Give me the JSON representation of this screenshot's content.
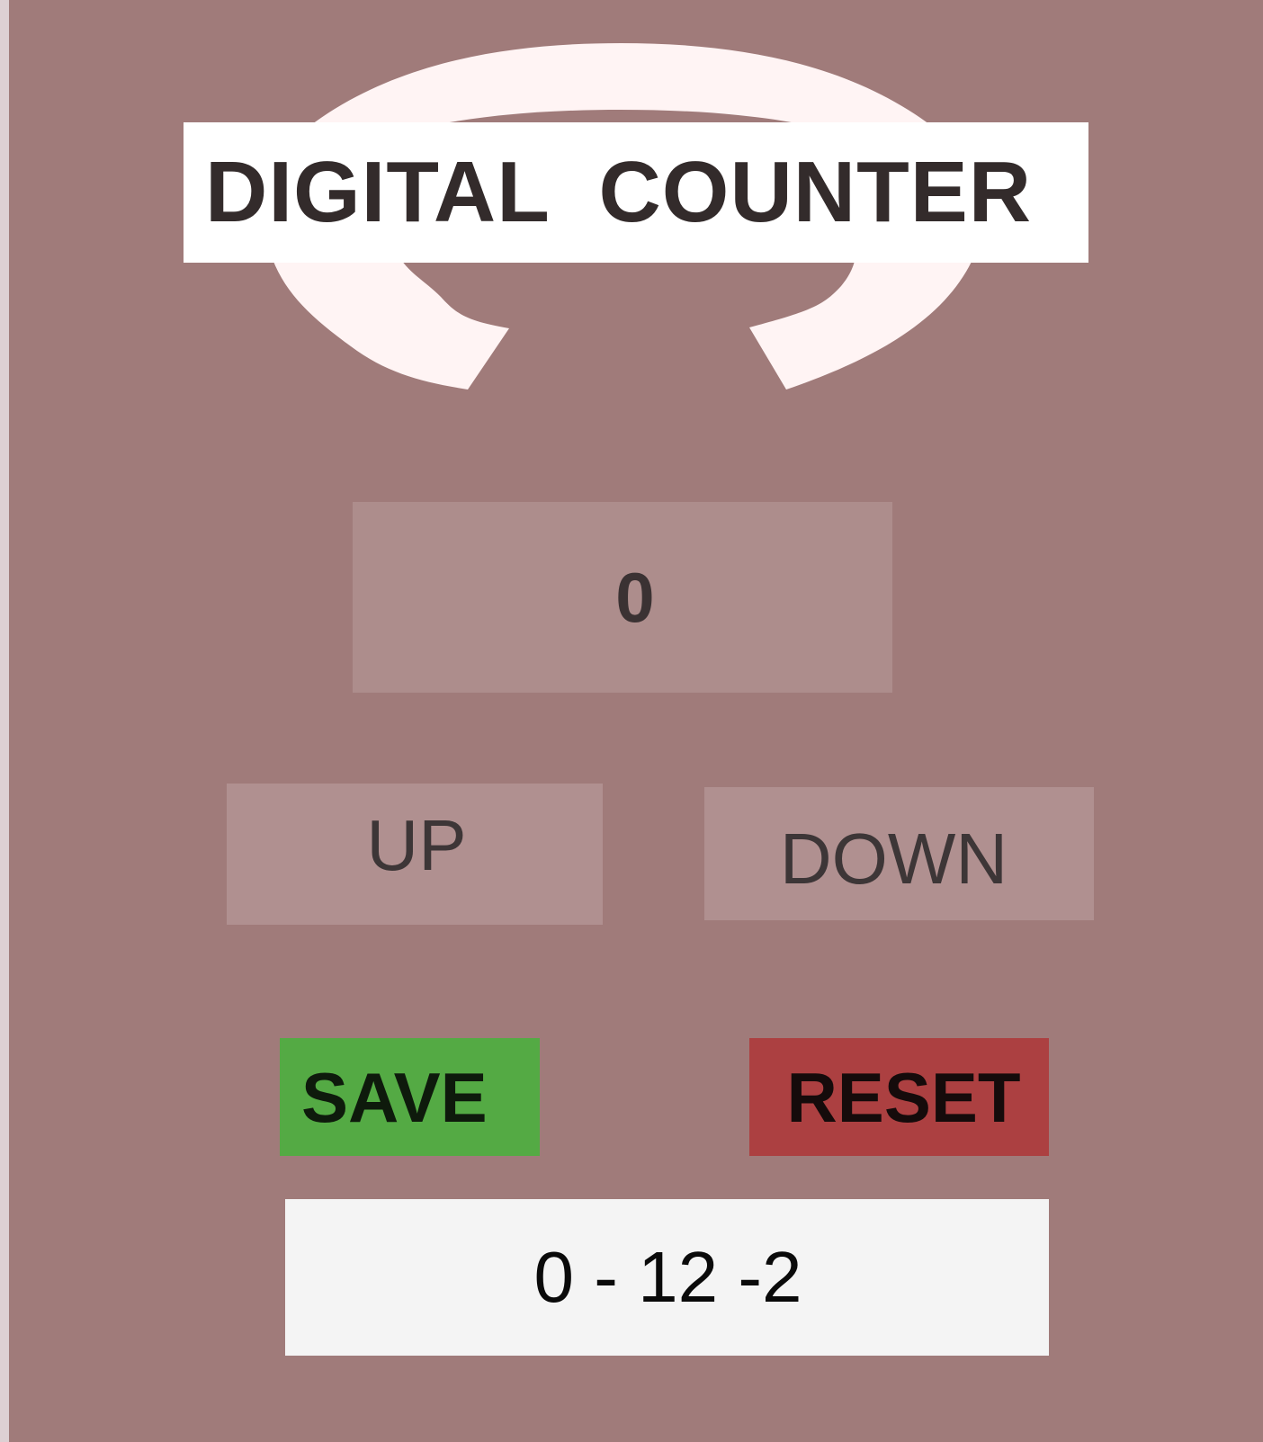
{
  "app": {
    "title": "DIGITAL  COUNTER"
  },
  "counter": {
    "value": "0"
  },
  "controls": {
    "up_label": "UP",
    "down_label": "DOWN",
    "save_label": "SAVE",
    "reset_label": "RESET"
  },
  "saved": {
    "text": "0 - 12 -2"
  },
  "icons": {
    "emblem": "refresh-arrows-icon"
  },
  "colors": {
    "background": "#a07b7a",
    "emblem": "#fff4f4",
    "save": "#54aa44",
    "reset": "#ac4041",
    "display": "#ad8d8c",
    "button": "#b09090"
  }
}
